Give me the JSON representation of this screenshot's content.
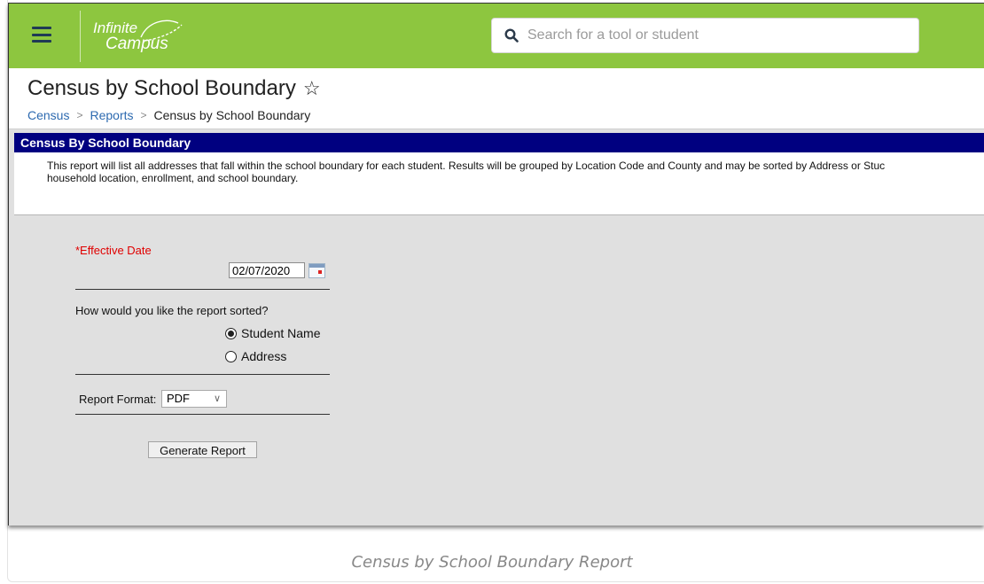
{
  "header": {
    "logo_line1": "Infinite",
    "logo_line2": "Campus",
    "search_placeholder": "Search for a tool or student"
  },
  "page": {
    "title": "Census by School Boundary",
    "breadcrumb": [
      "Census",
      "Reports",
      "Census by School Boundary"
    ]
  },
  "report": {
    "section_title": "Census By School Boundary",
    "description_line1": "This report will list all addresses that fall within the school boundary for each student. Results will be grouped by Location Code and County and may be sorted by Address or Stuc",
    "description_line2": "household location, enrollment, and school boundary.",
    "effective_date_label": "*Effective Date",
    "effective_date_value": "02/07/2020",
    "sort_question": "How would you like the report sorted?",
    "sort_options": [
      {
        "label": "Student Name",
        "checked": true
      },
      {
        "label": "Address",
        "checked": false
      }
    ],
    "format_label": "Report Format:",
    "format_value": "PDF",
    "generate_label": "Generate Report"
  },
  "caption": "Census by School Boundary Report",
  "colors": {
    "header_green": "#8dc63f",
    "section_navy": "#000080",
    "required_red": "#e00000",
    "link_blue": "#2d6ab0"
  }
}
